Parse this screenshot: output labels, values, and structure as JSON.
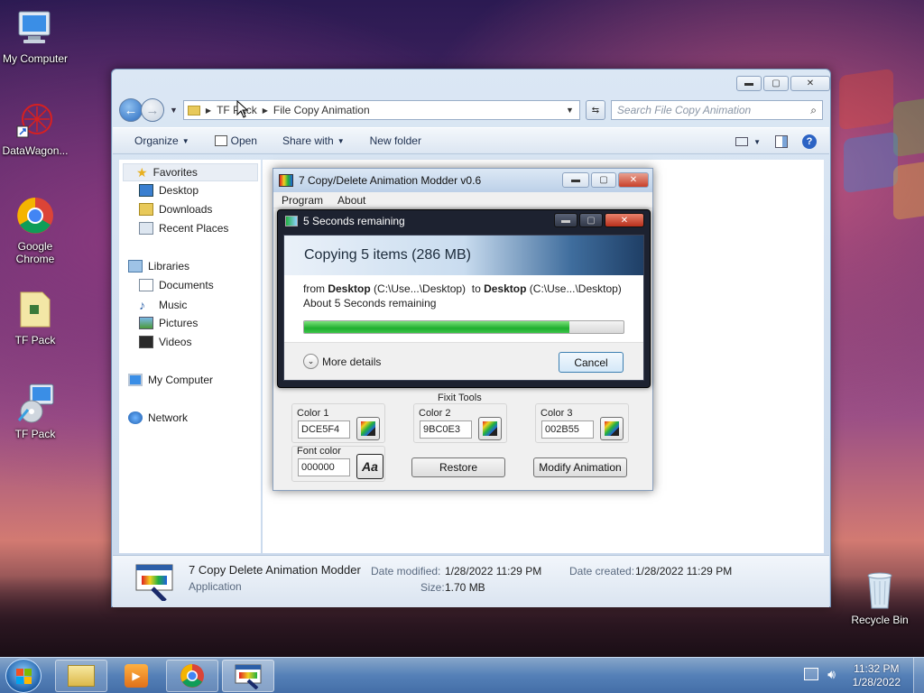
{
  "desktop": {
    "icons": [
      {
        "label": "My Computer"
      },
      {
        "label": "DataWagon..."
      },
      {
        "label": "Google Chrome"
      },
      {
        "label": "TF Pack"
      },
      {
        "label": "TF Pack"
      },
      {
        "label": "Recycle Bin"
      }
    ]
  },
  "explorer": {
    "breadcrumb": [
      "TF Pack",
      "File Copy Animation"
    ],
    "search_placeholder": "Search File Copy Animation",
    "toolbar": {
      "organize": "Organize",
      "open": "Open",
      "share_with": "Share with",
      "new_folder": "New folder"
    },
    "nav": {
      "favorites": "Favorites",
      "favorites_items": [
        "Desktop",
        "Downloads",
        "Recent Places"
      ],
      "libraries": "Libraries",
      "libraries_items": [
        "Documents",
        "Music",
        "Pictures",
        "Videos"
      ],
      "my_computer": "My Computer",
      "network": "Network"
    },
    "details": {
      "name": "7 Copy Delete Animation Modder",
      "type": "Application",
      "date_modified_label": "Date modified:",
      "date_modified": "1/28/2022 11:29 PM",
      "date_created_label": "Date created:",
      "date_created": "1/28/2022 11:29 PM",
      "size_label": "Size:",
      "size": "1.70 MB"
    }
  },
  "modder": {
    "title": "7 Copy/Delete Animation Modder v0.6",
    "menu": [
      "Program",
      "About"
    ],
    "fixit_label": "Fixit Tools",
    "color1_label": "Color 1",
    "color1": "DCE5F4",
    "color2_label": "Color 2",
    "color2": "9BC0E3",
    "color3_label": "Color 3",
    "color3": "002B55",
    "font_label": "Font color",
    "font_color": "000000",
    "font_btn": "Aa",
    "restore": "Restore",
    "modify": "Modify Animation"
  },
  "copy_dialog": {
    "title": "5 Seconds remaining",
    "heading": "Copying 5 items (286 MB)",
    "from_prefix": "from",
    "from_name": "Desktop",
    "from_path": "(C:\\Use...\\Desktop)",
    "to_prefix": "to",
    "to_name": "Desktop",
    "to_path": "(C:\\Use...\\Desktop)",
    "time_left": "About 5 Seconds remaining",
    "progress": 0.83,
    "more_details": "More details",
    "cancel": "Cancel"
  },
  "taskbar": {
    "time": "11:32 PM",
    "date": "1/28/2022"
  },
  "colors": {
    "progress_green": "#1fae2e",
    "title_accent": "#1f3f66"
  }
}
